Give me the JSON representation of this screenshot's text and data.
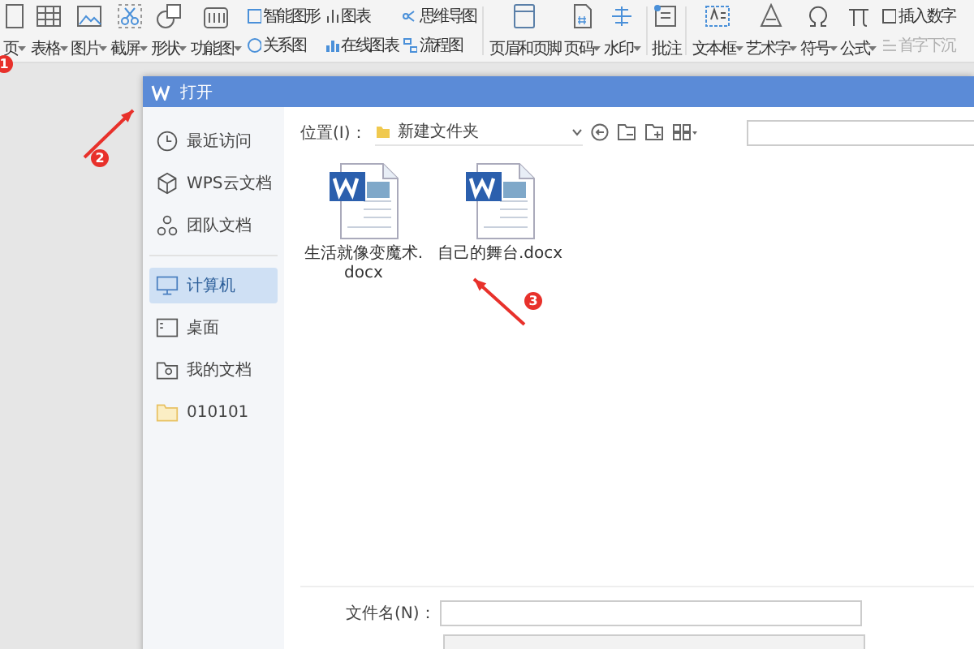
{
  "ribbon": {
    "large_items": [
      {
        "label": "页",
        "dropdown": true
      },
      {
        "label": "表格",
        "dropdown": true
      },
      {
        "label": "图片",
        "dropdown": true
      },
      {
        "label": "截屏",
        "dropdown": true
      },
      {
        "label": "形状",
        "dropdown": true
      },
      {
        "label": "功能图",
        "dropdown": true
      }
    ],
    "small_items": [
      {
        "label": "智能图形",
        "disabled": false
      },
      {
        "label": "关系图",
        "disabled": false
      },
      {
        "label": "图表",
        "disabled": false
      },
      {
        "label": "在线图表",
        "disabled": false
      },
      {
        "label": "思维导图",
        "disabled": false
      },
      {
        "label": "流程图",
        "disabled": false
      }
    ],
    "insert_items": [
      {
        "label": "页眉和页脚",
        "dropdown": false
      },
      {
        "label": "页码",
        "dropdown": true
      },
      {
        "label": "水印",
        "dropdown": true
      },
      {
        "label": "批注",
        "dropdown": false
      },
      {
        "label": "文本框",
        "dropdown": true
      },
      {
        "label": "艺术字",
        "dropdown": true
      },
      {
        "label": "符号",
        "dropdown": true
      },
      {
        "label": "公式",
        "dropdown": true
      }
    ],
    "extra_items": [
      {
        "label": "插入数字",
        "disabled": false
      },
      {
        "label": "首字下沉",
        "disabled": true
      }
    ]
  },
  "dialog": {
    "title": "打开",
    "sidebar": {
      "items": [
        {
          "label": "最近访问",
          "selected": false
        },
        {
          "label": "WPS云文档",
          "selected": false
        },
        {
          "label": "团队文档",
          "selected": false
        },
        {
          "label": "计算机",
          "selected": true
        },
        {
          "label": "桌面",
          "selected": false
        },
        {
          "label": "我的文档",
          "selected": false
        },
        {
          "label": "010101",
          "selected": false
        }
      ]
    },
    "location": {
      "label": "位置(I)：",
      "value": "新建文件夹"
    },
    "files": [
      {
        "name": "生活就像变魔术.docx"
      },
      {
        "name": "自己的舞台.docx"
      }
    ],
    "filename": {
      "label": "文件名(N)："
    }
  },
  "annotations": [
    {
      "number": "1"
    },
    {
      "number": "2"
    },
    {
      "number": "3"
    }
  ]
}
